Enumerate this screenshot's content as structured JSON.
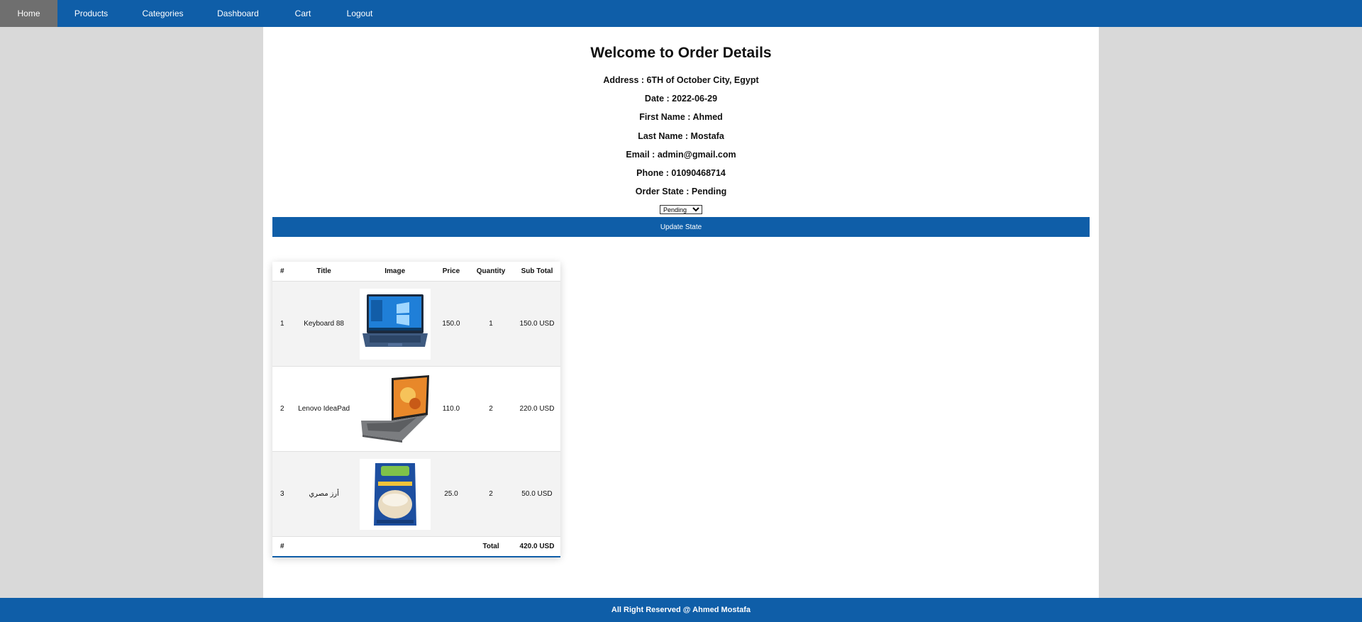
{
  "nav": {
    "items": [
      {
        "label": "Home",
        "active": true
      },
      {
        "label": "Products"
      },
      {
        "label": "Categories"
      },
      {
        "label": "Dashboard"
      },
      {
        "label": "Cart"
      },
      {
        "label": "Logout"
      }
    ]
  },
  "order": {
    "title": "Welcome to Order Details",
    "address": "Address : 6TH of October City, Egypt",
    "date": "Date : 2022-06-29",
    "first_name": "First Name : Ahmed",
    "last_name": "Last Name : Mostafa",
    "email": "Email : admin@gmail.com",
    "phone": "Phone : 01090468714",
    "state": "Order State : Pending",
    "state_select_value": "Pending",
    "update_label": "Update State"
  },
  "table": {
    "headers": [
      "#",
      "Title",
      "Image",
      "Price",
      "Quantity",
      "Sub Total"
    ],
    "rows": [
      {
        "num": "1",
        "title": "Keyboard 88",
        "image": "laptop-blue-windows-image",
        "price": "150.0",
        "quantity": "1",
        "subtotal": "150.0 USD"
      },
      {
        "num": "2",
        "title": "Lenovo IdeaPad",
        "image": "laptop-grey-orange-screen-image",
        "price": "110.0",
        "quantity": "2",
        "subtotal": "220.0 USD"
      },
      {
        "num": "3",
        "title": "أرز مصري",
        "image": "rice-bag-image",
        "price": "25.0",
        "quantity": "2",
        "subtotal": "50.0 USD"
      }
    ],
    "footer": {
      "num": "#",
      "total_label": "Total",
      "total_value": "420.0 USD"
    }
  },
  "footer": {
    "text": "All Right Reserved @ Ahmed Mostafa"
  },
  "colors": {
    "primary": "#0f5ea8",
    "nav_active": "#6f6f6f",
    "background": "#d9d9d9"
  }
}
